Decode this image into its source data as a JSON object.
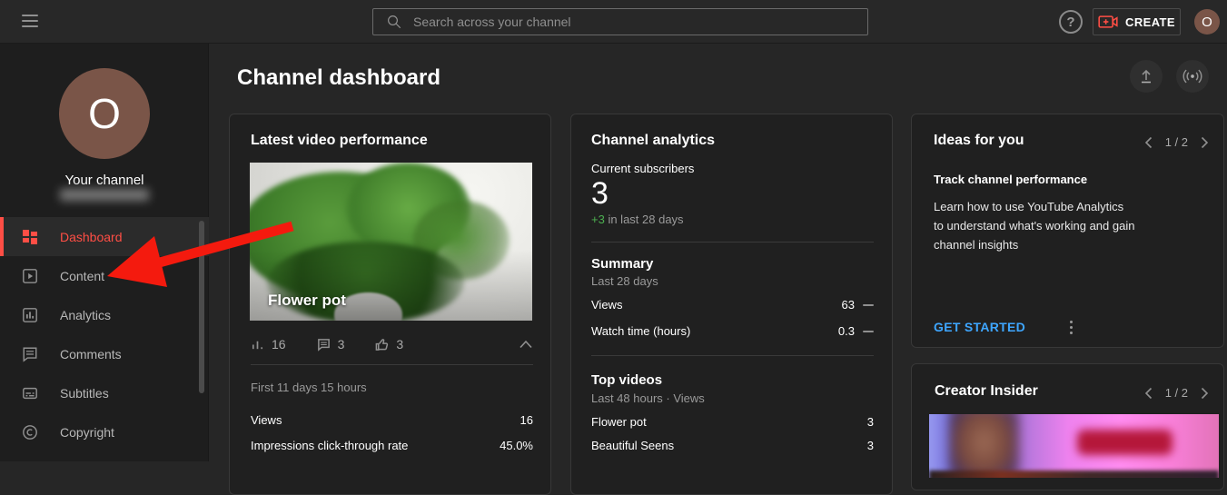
{
  "colors": {
    "accent_red": "#ff4e45",
    "arrow_red": "#f41a0e",
    "link_blue": "#3ea6ff",
    "positive_green": "#4caf50",
    "avatar_brown": "#7a5548"
  },
  "topbar": {
    "search_placeholder": "Search across your channel",
    "create_label": "CREATE",
    "help_glyph": "?",
    "avatar_initial": "O"
  },
  "sidebar": {
    "avatar_initial": "O",
    "your_channel_label": "Your channel",
    "items": [
      {
        "label": "Dashboard",
        "active": true
      },
      {
        "label": "Content",
        "active": false
      },
      {
        "label": "Analytics",
        "active": false
      },
      {
        "label": "Comments",
        "active": false
      },
      {
        "label": "Subtitles",
        "active": false
      },
      {
        "label": "Copyright",
        "active": false
      }
    ]
  },
  "main": {
    "title": "Channel dashboard"
  },
  "cards": {
    "latest": {
      "title": "Latest video performance",
      "video_title": "Flower pot",
      "stats": {
        "views": "16",
        "comments": "3",
        "likes": "3"
      },
      "period": "First 11 days 15 hours",
      "rows": [
        {
          "label": "Views",
          "value": "16"
        },
        {
          "label": "Impressions click-through rate",
          "value": "45.0%"
        }
      ]
    },
    "analytics": {
      "title": "Channel analytics",
      "subscribers_label": "Current subscribers",
      "subscribers_value": "3",
      "subscribers_delta": "+3",
      "subscribers_delta_suffix": "in last 28 days",
      "summary_title": "Summary",
      "summary_period": "Last 28 days",
      "summary_rows": [
        {
          "label": "Views",
          "value": "63"
        },
        {
          "label": "Watch time (hours)",
          "value": "0.3"
        }
      ],
      "top_videos_title": "Top videos",
      "top_videos_period": "Last 48 hours · Views",
      "top_videos": [
        {
          "label": "Flower pot",
          "value": "3"
        },
        {
          "label": "Beautiful Seens",
          "value": "3"
        }
      ]
    },
    "ideas": {
      "title": "Ideas for you",
      "pagination": "1 / 2",
      "item_title": "Track channel performance",
      "item_body": "Learn how to use YouTube Analytics to understand what's working and gain channel insights",
      "cta": "GET STARTED"
    },
    "insider": {
      "title": "Creator Insider",
      "pagination": "1 / 2"
    }
  }
}
